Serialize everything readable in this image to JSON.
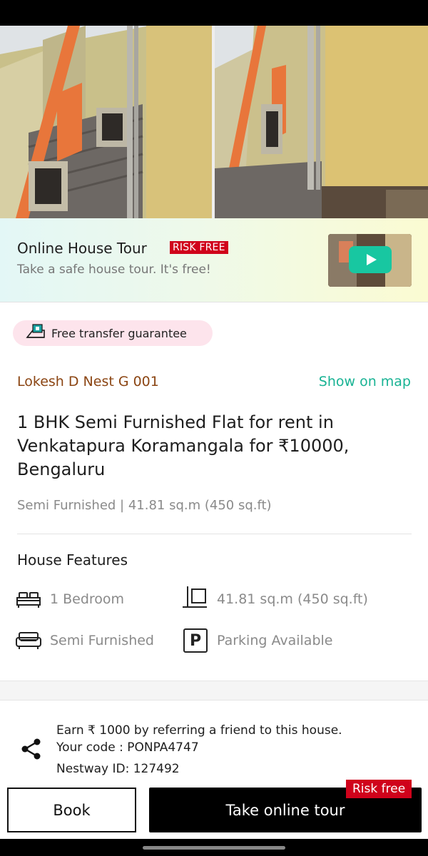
{
  "tour_banner": {
    "title": "Online House Tour",
    "badge": "RISK FREE",
    "subtitle": "Take a safe house tour. It's free!",
    "badge_color": "#d0021b",
    "play_color": "#18c7a1"
  },
  "guarantee": {
    "label": "Free transfer guarantee",
    "icon": "truck-icon"
  },
  "listing": {
    "lister_name": "Lokesh D Nest G 001",
    "show_on_map": "Show on map",
    "title": "1 BHK Semi Furnished Flat for rent in Venkatapura Koramangala for ₹10000, Bengaluru",
    "summary": "Semi Furnished | 41.81 sq.m (450 sq.ft)"
  },
  "features": {
    "heading": "House Features",
    "items": [
      {
        "icon": "bed-icon",
        "label": "1 Bedroom"
      },
      {
        "icon": "area-icon",
        "label": "41.81 sq.m (450 sq.ft)"
      },
      {
        "icon": "sofa-icon",
        "label": "Semi Furnished"
      },
      {
        "icon": "parking-icon",
        "label": "Parking Available",
        "glyph": "P"
      }
    ]
  },
  "referral": {
    "line1": "Earn ₹ 1000 by referring a friend to this house.",
    "line2": "Your code : PONPA4747",
    "nestway_id": "Nestway ID: 127492",
    "icon": "share-icon"
  },
  "actions": {
    "book_label": "Book",
    "tour_label": "Take online tour",
    "tour_badge": "Risk free"
  },
  "colors": {
    "accent_green": "#19b394",
    "lister_brown": "#8b4513",
    "badge_red": "#d0021b"
  }
}
